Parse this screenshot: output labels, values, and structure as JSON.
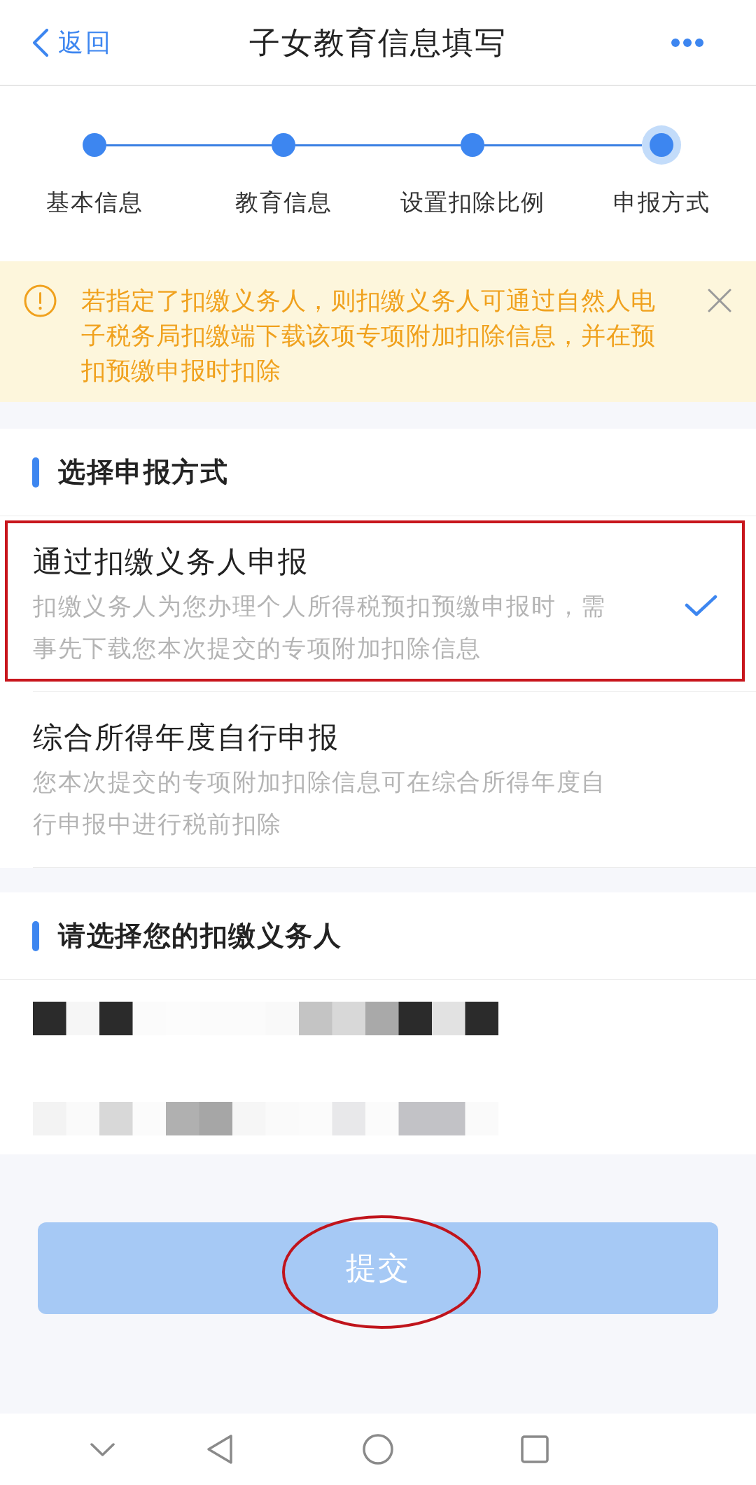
{
  "header": {
    "back_label": "返回",
    "title": "子女教育信息填写"
  },
  "steps": [
    {
      "label": "基本信息",
      "current": false
    },
    {
      "label": "教育信息",
      "current": false
    },
    {
      "label": "设置扣除比例",
      "current": false
    },
    {
      "label": "申报方式",
      "current": true
    }
  ],
  "notice": {
    "text": "若指定了扣缴义务人，则扣缴义务人可通过自然人电子税务局扣缴端下载该项专项附加扣除信息，并在预扣预缴申报时扣除"
  },
  "method_section": {
    "heading": "选择申报方式",
    "options": [
      {
        "title": "通过扣缴义务人申报",
        "description": "扣缴义务人为您办理个人所得税预扣预缴申报时，需事先下载您本次提交的专项附加扣除信息",
        "selected": true,
        "highlighted": true
      },
      {
        "title": "综合所得年度自行申报",
        "description": "您本次提交的专项附加扣除信息可在综合所得年度自行申报中进行税前扣除",
        "selected": false,
        "highlighted": false
      }
    ]
  },
  "agent_section": {
    "heading": "请选择您的扣缴义务人"
  },
  "submit": {
    "label": "提交",
    "disabled": true,
    "circled": true
  }
}
